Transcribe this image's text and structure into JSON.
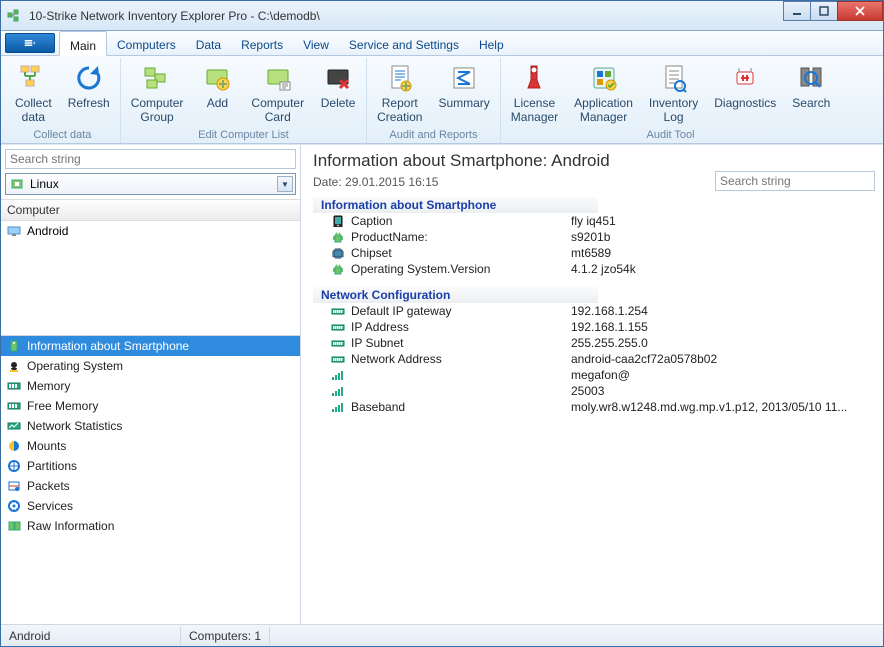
{
  "window": {
    "title": "10-Strike Network Inventory Explorer Pro - C:\\demodb\\"
  },
  "menu": {
    "file_icon": "menu",
    "tabs": [
      "Main",
      "Computers",
      "Data",
      "Reports",
      "View",
      "Service and Settings",
      "Help"
    ],
    "active": 0
  },
  "ribbon": {
    "groups": [
      {
        "label": "Collect data",
        "buttons": [
          {
            "key": "collect",
            "label": "Collect\ndata"
          },
          {
            "key": "refresh",
            "label": "Refresh"
          }
        ]
      },
      {
        "label": "Edit Computer List",
        "buttons": [
          {
            "key": "group",
            "label": "Computer\nGroup"
          },
          {
            "key": "add",
            "label": "Add"
          },
          {
            "key": "card",
            "label": "Computer\nCard"
          },
          {
            "key": "delete",
            "label": "Delete"
          }
        ]
      },
      {
        "label": "Audit and Reports",
        "buttons": [
          {
            "key": "report",
            "label": "Report\nCreation"
          },
          {
            "key": "summary",
            "label": "Summary"
          }
        ]
      },
      {
        "label": "Audit Tool",
        "buttons": [
          {
            "key": "license",
            "label": "License\nManager"
          },
          {
            "key": "appmgr",
            "label": "Application\nManager"
          },
          {
            "key": "invlog",
            "label": "Inventory\nLog"
          },
          {
            "key": "diag",
            "label": "Diagnostics"
          },
          {
            "key": "search",
            "label": "Search"
          }
        ]
      }
    ]
  },
  "left": {
    "search_placeholder": "Search string",
    "combo_text": "Linux",
    "col_header": "Computer",
    "tree": [
      {
        "label": "Android"
      }
    ],
    "categories": [
      "Information about Smartphone",
      "Operating System",
      "Memory",
      "Free Memory",
      "Network Statistics",
      "Mounts",
      "Partitions",
      "Packets",
      "Services",
      "Raw Information"
    ],
    "selected": 0
  },
  "right": {
    "title": "Information about Smartphone: Android",
    "date": "Date: 29.01.2015 16:15",
    "search_placeholder": "Search string",
    "sections": [
      {
        "title": "Information about Smartphone",
        "rows": [
          {
            "k": "Caption",
            "v": "fly iq451",
            "ic": "phone"
          },
          {
            "k": "ProductName:",
            "v": "s9201b",
            "ic": "android"
          },
          {
            "k": "Chipset",
            "v": "mt6589",
            "ic": "chip"
          },
          {
            "k": "Operating System.Version",
            "v": "4.1.2 jzo54k",
            "ic": "android"
          }
        ]
      },
      {
        "title": "Network Configuration",
        "rows": [
          {
            "k": "Default IP gateway",
            "v": "192.168.1.254",
            "ic": "net"
          },
          {
            "k": "IP Address",
            "v": "192.168.1.155",
            "ic": "net"
          },
          {
            "k": "IP Subnet",
            "v": "255.255.255.0",
            "ic": "net"
          },
          {
            "k": "Network Address",
            "v": "android-caa2cf72a0578b02",
            "ic": "net"
          },
          {
            "k": "",
            "v": "megafon@",
            "ic": "bars"
          },
          {
            "k": "",
            "v": "25003",
            "ic": "bars"
          },
          {
            "k": "Baseband",
            "v": "moly.wr8.w1248.md.wg.mp.v1.p12, 2013/05/10 11...",
            "ic": "bars"
          }
        ]
      }
    ]
  },
  "status": {
    "left": "Android",
    "right": "Computers: 1"
  }
}
